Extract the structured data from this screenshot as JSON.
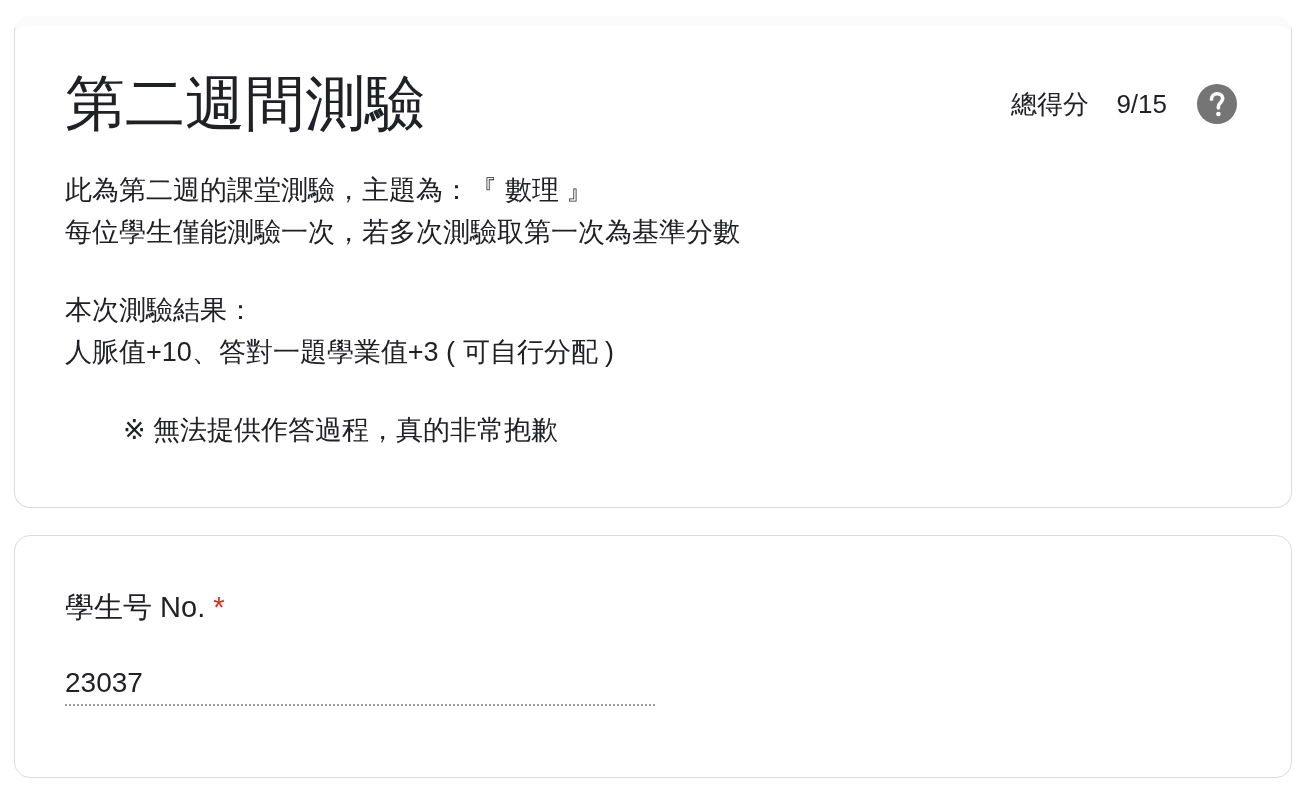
{
  "header": {
    "title": "第二週間測驗",
    "score": {
      "label": "總得分",
      "value": "9/15"
    }
  },
  "description": [
    {
      "kind": "paragraph",
      "lines": [
        "此為第二週的課堂測驗，主題為：『 數理 』",
        "每位學生僅能測驗一次，若多次測驗取第一次為基準分數"
      ]
    },
    {
      "kind": "paragraph",
      "lines": [
        "本次測驗結果：",
        "人脈值+10、答對一題學業值+3 ( 可自行分配 )"
      ]
    },
    {
      "kind": "note",
      "lines": [
        "※ 無法提供作答過程，真的非常抱歉"
      ]
    }
  ],
  "questions": [
    {
      "label": "學生号 No.",
      "required_mark": "*",
      "answer": "23037"
    }
  ]
}
